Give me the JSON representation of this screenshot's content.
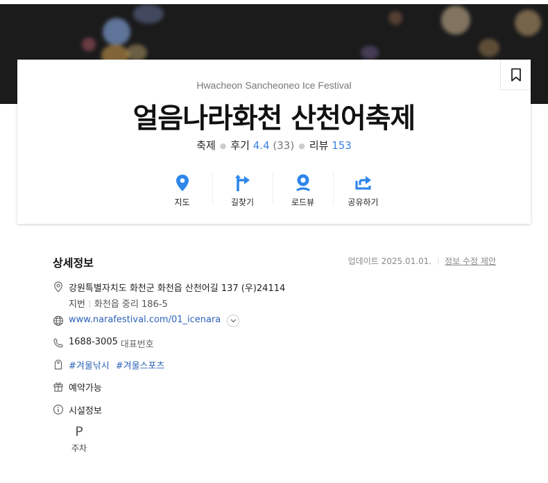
{
  "header": {
    "english_name": "Hwacheon Sancheoneo Ice Festival",
    "title": "얼음나라화천 산천어축제",
    "category": "축제",
    "review_label": "후기",
    "review_score": "4.4",
    "review_count": "(33)",
    "blog_label": "리뷰",
    "blog_count": "153"
  },
  "actions": [
    {
      "label": "지도",
      "icon": "map-pin-icon"
    },
    {
      "label": "길찾기",
      "icon": "directions-icon"
    },
    {
      "label": "로드뷰",
      "icon": "roadview-icon"
    },
    {
      "label": "공유하기",
      "icon": "share-icon"
    }
  ],
  "details": {
    "section_title": "상세정보",
    "updated": "업데이트 2025.01.01.",
    "suggest_edit": "정보 수정 제안",
    "address": "강원특별자치도 화천군 화천읍 산천어길 137 (우)24114",
    "jibun_label": "지번",
    "jibun": "화천읍 중리 186-5",
    "website": "www.narafestival.com/01_icenara",
    "phone": "1688-3005",
    "phone_label": "대표번호",
    "tags": [
      "#겨울낚시",
      "#겨울스포츠"
    ],
    "reservation": "예약가능",
    "facility_title": "시설정보",
    "facility_parking_glyph": "P",
    "facility_parking": "주차"
  },
  "colors": {
    "accent": "#3b82e0",
    "link": "#2b63b8",
    "hero_bg": "#1b1b1c"
  }
}
